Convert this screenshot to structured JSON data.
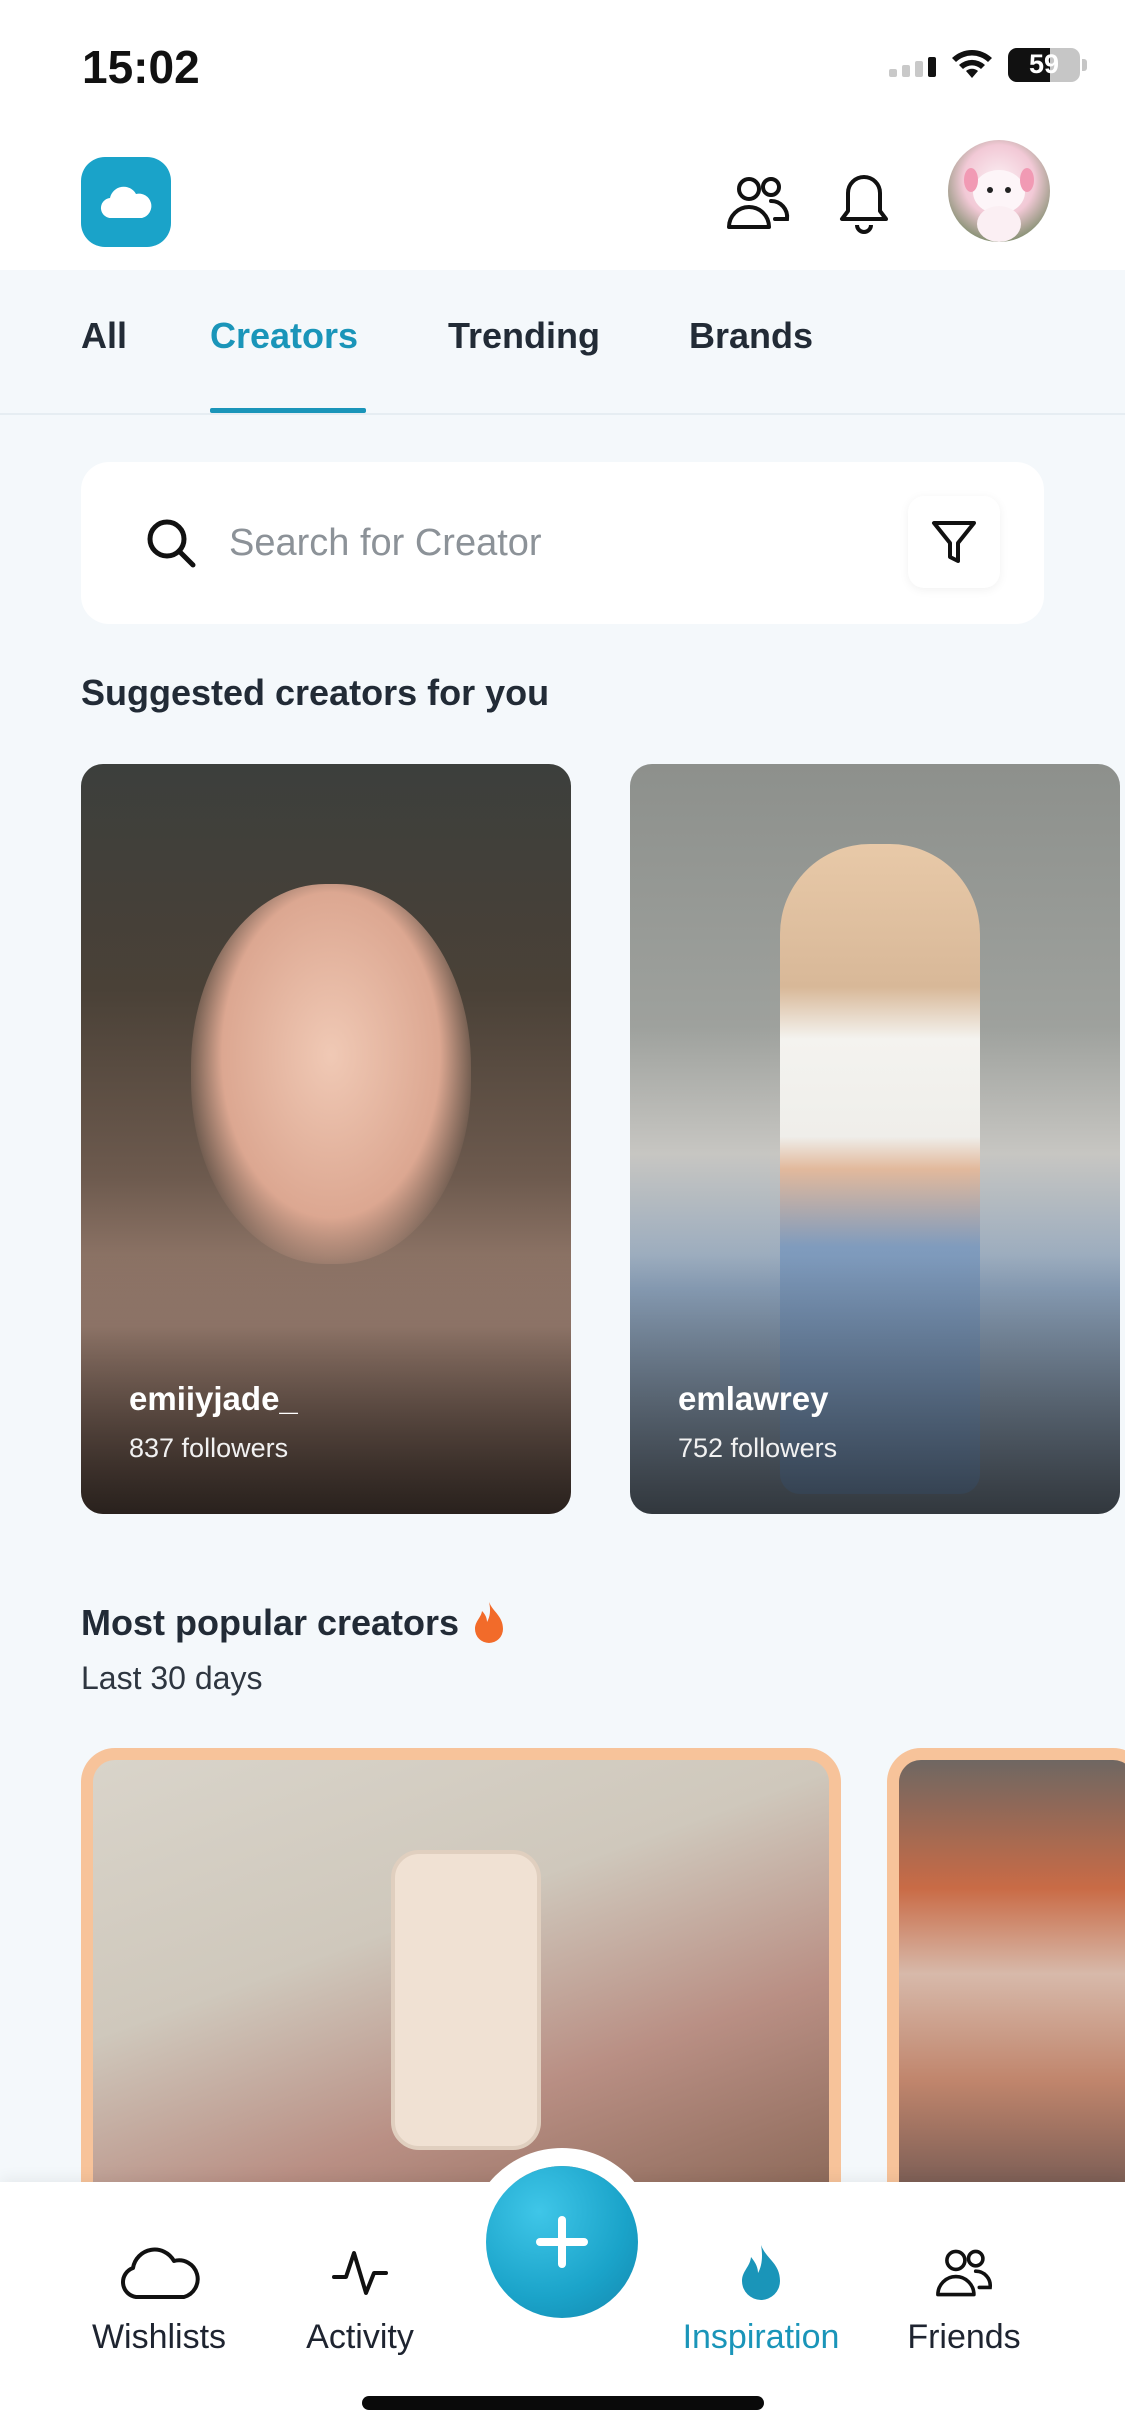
{
  "status_bar": {
    "time": "15:02",
    "battery": "59"
  },
  "header": {
    "logo_icon": "cloud-icon",
    "friends_icon": "people-icon",
    "notifications_icon": "bell-icon"
  },
  "tabs": [
    {
      "label": "All"
    },
    {
      "label": "Creators",
      "active": true
    },
    {
      "label": "Trending"
    },
    {
      "label": "Brands"
    }
  ],
  "search": {
    "placeholder": "Search for Creator",
    "value": ""
  },
  "suggested": {
    "title": "Suggested creators for you",
    "creators": [
      {
        "name": "emiiyjade_",
        "followers": "837 followers"
      },
      {
        "name": "emlawrey",
        "followers": "752 followers"
      }
    ]
  },
  "popular": {
    "title": "Most popular creators",
    "subtitle": "Last 30 days"
  },
  "bottom_nav": [
    {
      "label": "Wishlists",
      "icon": "cloud-icon"
    },
    {
      "label": "Activity",
      "icon": "activity-icon"
    },
    {
      "label": "Inspiration",
      "icon": "flame-icon",
      "active": true
    },
    {
      "label": "Friends",
      "icon": "people-icon"
    }
  ],
  "colors": {
    "accent": "#1a95b9",
    "logo": "#1aa3c9",
    "popular_border": "#f7c39a",
    "flame": "#f26b2a"
  }
}
